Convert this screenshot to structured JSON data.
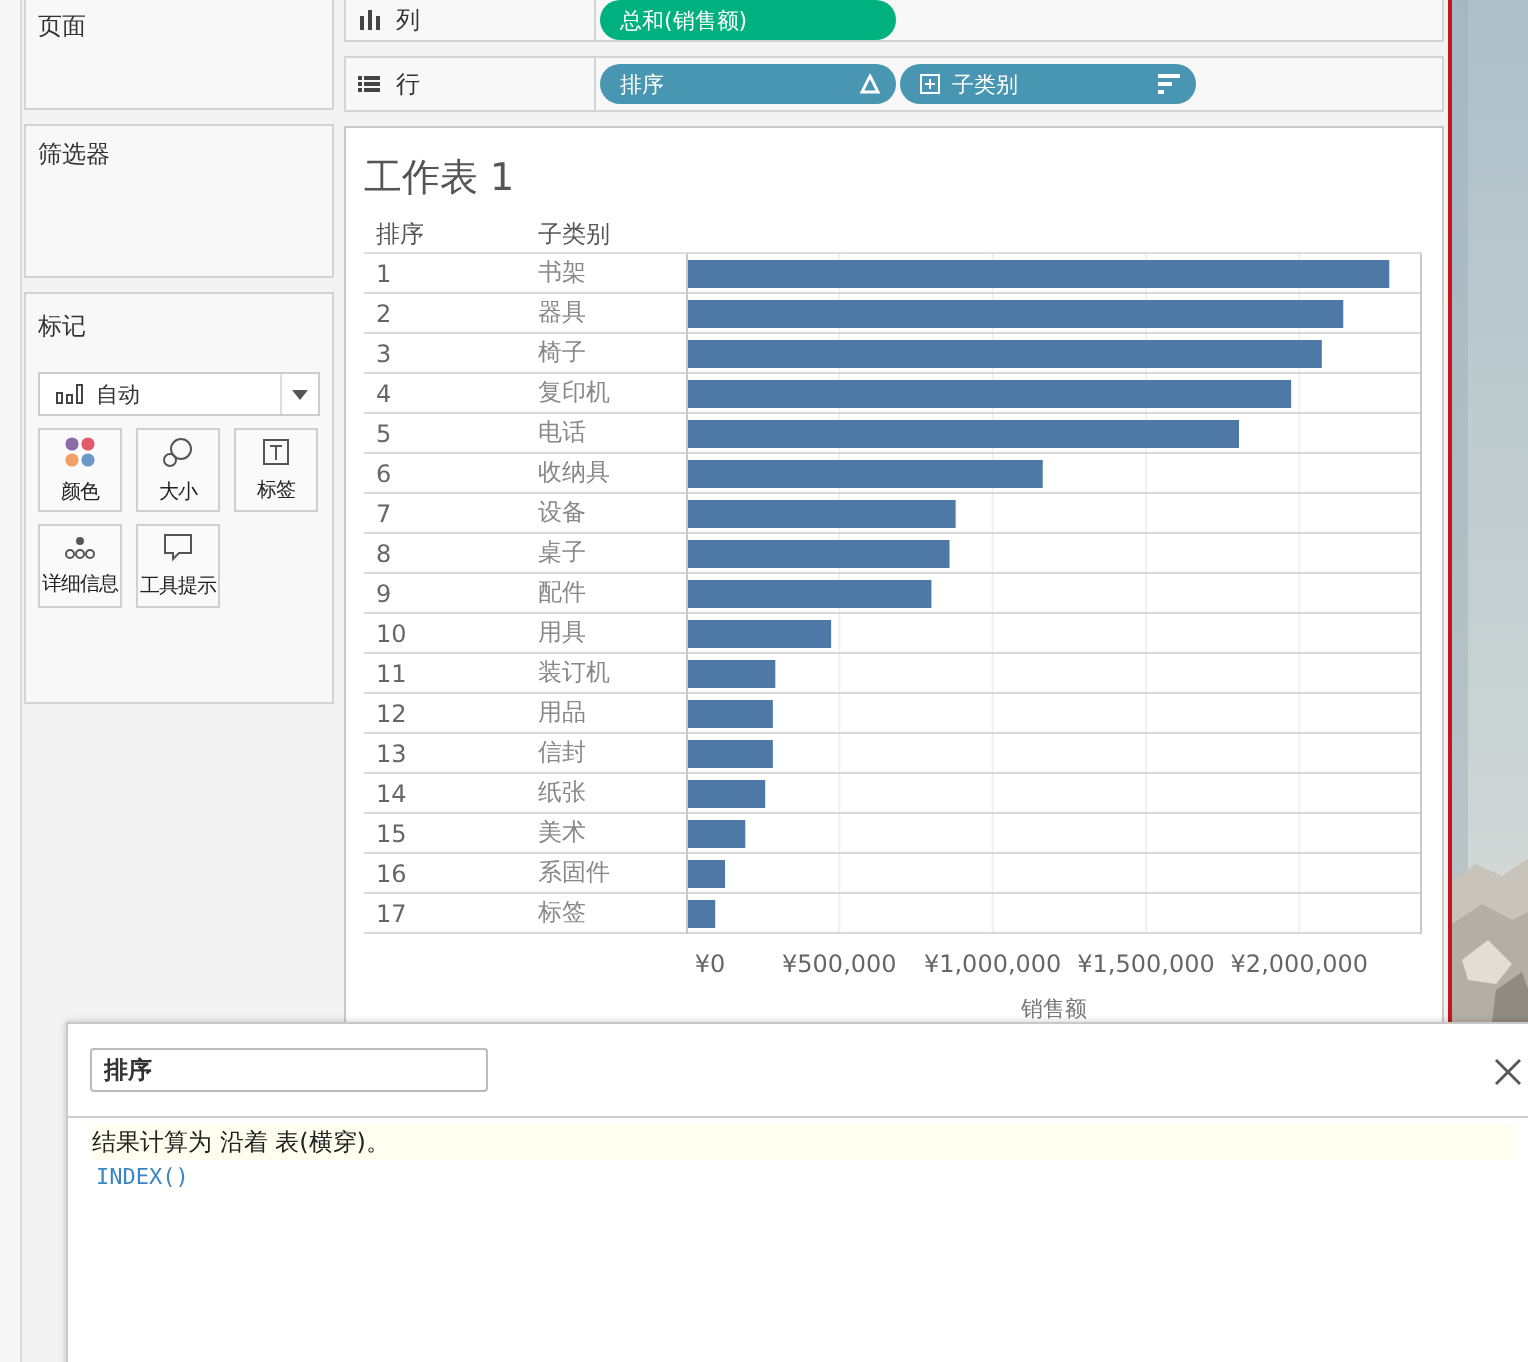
{
  "cards": {
    "pages": {
      "title": "页面"
    },
    "filters": {
      "title": "筛选器"
    },
    "marks": {
      "title": "标记",
      "mark_type": "自动",
      "buttons": [
        {
          "kind": "color",
          "label": "颜色"
        },
        {
          "kind": "size",
          "label": "大小"
        },
        {
          "kind": "label",
          "label": "标签"
        },
        {
          "kind": "detail",
          "label": "详细信息"
        },
        {
          "kind": "tooltip",
          "label": "工具提示"
        }
      ]
    }
  },
  "shelves": [
    {
      "kind": "columns",
      "label": "列",
      "pills": [
        {
          "kind": "measure",
          "label": "总和(销售额)"
        }
      ]
    },
    {
      "kind": "rows",
      "label": "行",
      "pills": [
        {
          "kind": "calc",
          "label": "排序"
        },
        {
          "kind": "dimension",
          "label": "子类别"
        }
      ]
    }
  ],
  "worksheet": {
    "title": "工作表 1",
    "headers": [
      "排序",
      "子类别"
    ],
    "rows": [
      {
        "rank": "1"
      },
      {
        "rank": "2"
      },
      {
        "rank": "3"
      },
      {
        "rank": "4"
      },
      {
        "rank": "5"
      },
      {
        "rank": "6"
      },
      {
        "rank": "7"
      },
      {
        "rank": "8"
      },
      {
        "rank": "9"
      },
      {
        "rank": "10"
      },
      {
        "rank": "11"
      },
      {
        "rank": "12"
      },
      {
        "rank": "13"
      },
      {
        "rank": "14"
      },
      {
        "rank": "15"
      },
      {
        "rank": "16"
      },
      {
        "rank": "17"
      }
    ],
    "chart_data": {
      "type": "bar",
      "orientation": "horizontal",
      "xlabel": "销售额",
      "categories": [
        "书架",
        "器具",
        "椅子",
        "复印机",
        "电话",
        "收纳具",
        "设备",
        "桌子",
        "配件",
        "用具",
        "装订机",
        "用品",
        "信封",
        "纸张",
        "美术",
        "系固件",
        "标签"
      ],
      "values": [
        2290000,
        2140000,
        2070000,
        1970000,
        1800000,
        1160000,
        876000,
        856000,
        797000,
        470000,
        288000,
        280000,
        280000,
        255000,
        190000,
        124000,
        92000
      ],
      "xlim": [
        0,
        2400000
      ],
      "grid": true,
      "xticks": [
        {
          "value": 0,
          "label": "¥0"
        },
        {
          "value": 500000,
          "label": "¥500,000"
        },
        {
          "value": 1000000,
          "label": "¥1,000,000"
        },
        {
          "value": 1500000,
          "label": "¥1,500,000"
        },
        {
          "value": 2000000,
          "label": "¥2,000,000"
        }
      ]
    }
  },
  "dialog": {
    "name": "排序",
    "info": "结果计算为 沿着 表(横穿)。",
    "formula": "INDEX()"
  }
}
